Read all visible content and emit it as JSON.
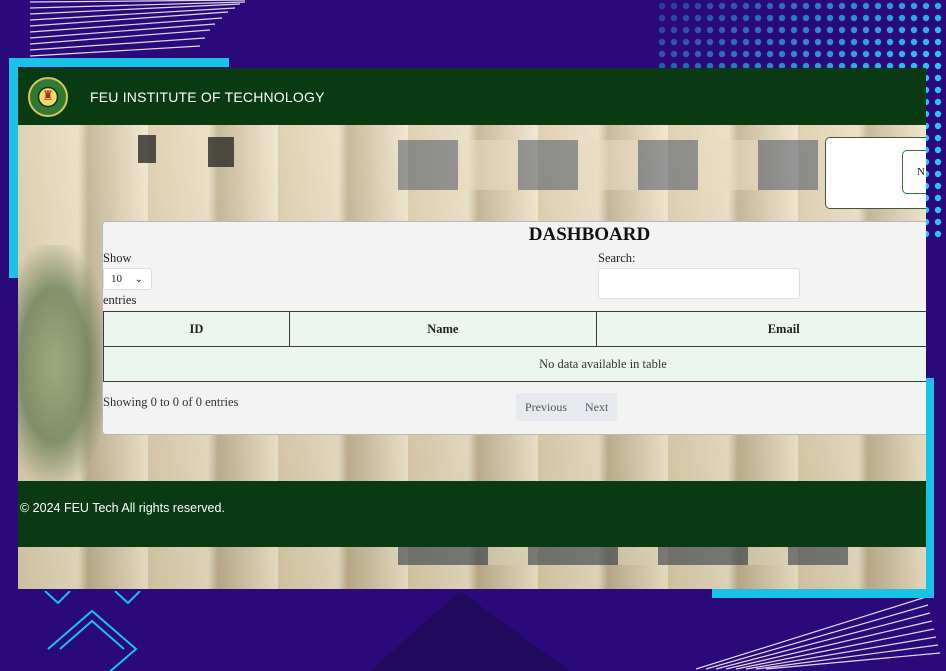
{
  "header": {
    "brand": "FEU INSTITUTE OF TECHNOLOGY"
  },
  "float_button": {
    "label": "N"
  },
  "dashboard": {
    "title": "DASHBOARD",
    "show_label": "Show",
    "page_length": "10",
    "entries_label": "entries",
    "search_label": "Search:",
    "search_value": "",
    "columns": [
      "ID",
      "Name",
      "Email"
    ],
    "empty_message": "No data available in table",
    "info": "Showing 0 to 0 of 0 entries",
    "pagination": {
      "previous": "Previous",
      "next": "Next"
    }
  },
  "footer": {
    "text": "© 2024 FEU Tech All rights reserved."
  },
  "colors": {
    "header_bg": "#0a3a12",
    "accent_cyan": "#19c3e6",
    "background": "#2a0a7a",
    "table_bg": "#eaf6ee"
  }
}
